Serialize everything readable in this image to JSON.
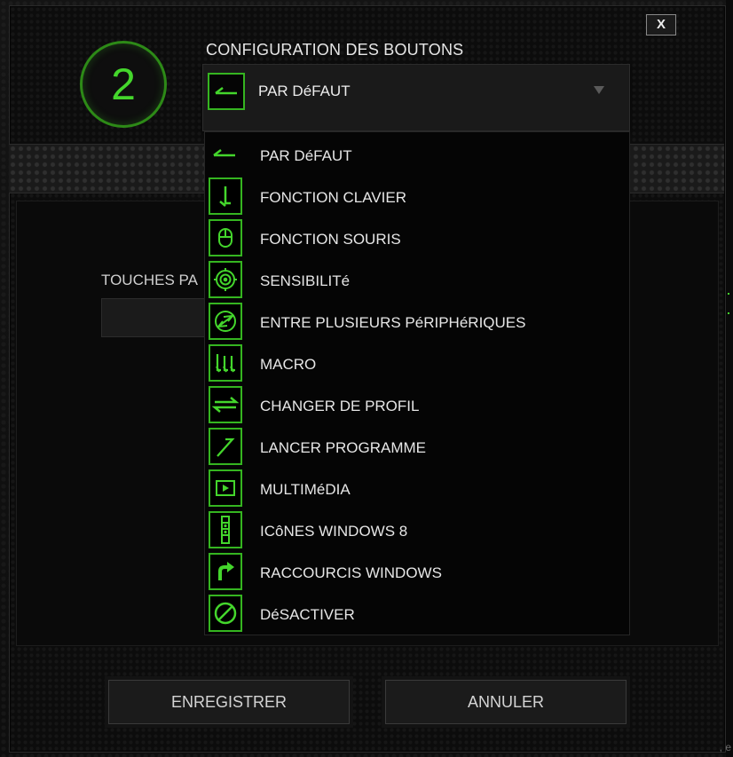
{
  "dialog": {
    "close_label": "X",
    "number": "2",
    "title": "CONFIGURATION DES BOUTONS",
    "selected": {
      "label": "PAR DéFAUT",
      "icon": "arrow-left-icon"
    },
    "touches_label": "TOUCHES PA",
    "menu_items": [
      {
        "label": "PAR DéFAUT",
        "icon": "arrow-left-icon"
      },
      {
        "label": "FONCTION CLAVIER",
        "icon": "keyboard-function-icon"
      },
      {
        "label": "FONCTION SOURIS",
        "icon": "mouse-icon"
      },
      {
        "label": "SENSIBILITé",
        "icon": "sensitivity-target-icon"
      },
      {
        "label": "ENTRE PLUSIEURS PéRIPHéRIQUES",
        "icon": "inter-device-icon"
      },
      {
        "label": "MACRO",
        "icon": "macro-icon"
      },
      {
        "label": "CHANGER DE PROFIL",
        "icon": "switch-profile-icon"
      },
      {
        "label": "LANCER PROGRAMME",
        "icon": "launch-program-icon"
      },
      {
        "label": "MULTIMéDIA",
        "icon": "multimedia-play-icon"
      },
      {
        "label": "ICôNES WINDOWS 8",
        "icon": "windows8-charms-icon"
      },
      {
        "label": "RACCOURCIS WINDOWS",
        "icon": "windows-shortcut-icon"
      },
      {
        "label": "DéSACTIVER",
        "icon": "disable-icon"
      }
    ],
    "save_label": "ENREGISTRER",
    "cancel_label": "ANNULER"
  },
  "colors": {
    "accent": "#44d62c",
    "accent_dark": "#35b520",
    "text": "#e6e6e6",
    "panel": "#1a1a1a"
  },
  "corner_text": ", e"
}
